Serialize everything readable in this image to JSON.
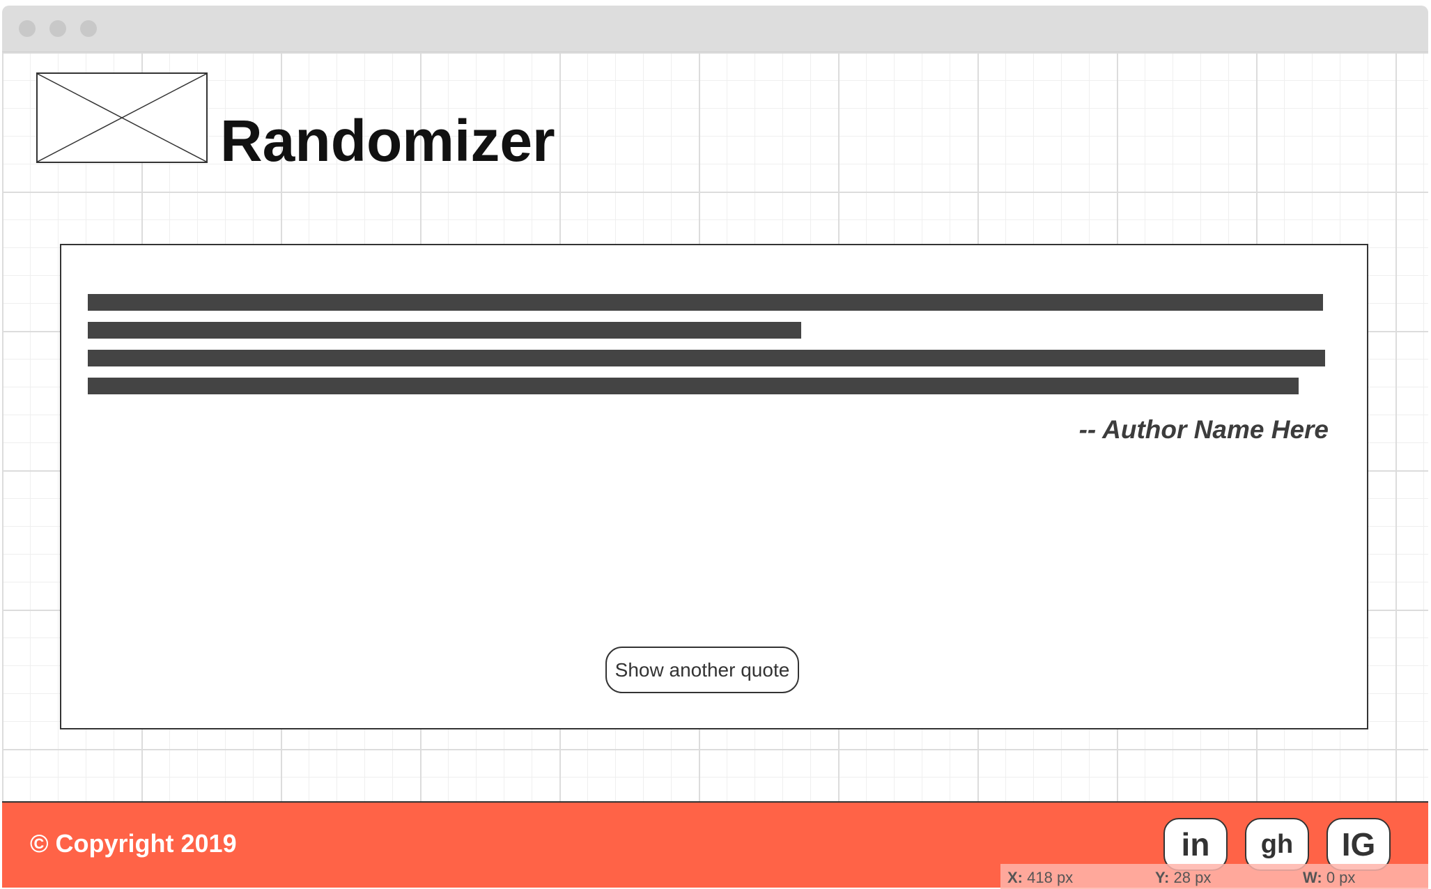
{
  "window": {
    "traffic_lights": [
      "close",
      "minimize",
      "zoom"
    ]
  },
  "header": {
    "logo_icon": "image-placeholder-icon",
    "title": "Randomizer"
  },
  "quote": {
    "text_lines_placeholder": 4,
    "author": "-- Author Name Here",
    "button_label": "Show another quote"
  },
  "footer": {
    "copyright": "© Copyright 2019",
    "background_color": "#ff6347",
    "social_links": [
      {
        "label": "in",
        "icon": "linkedin-icon"
      },
      {
        "label": "gh",
        "icon": "github-icon"
      },
      {
        "label": "IG",
        "icon": "instagram-icon"
      }
    ]
  },
  "inspector": {
    "x_label": "X:",
    "x_value": "418 px",
    "y_label": "Y:",
    "y_value": "28 px",
    "w_label": "W:",
    "w_value": "0 px"
  }
}
